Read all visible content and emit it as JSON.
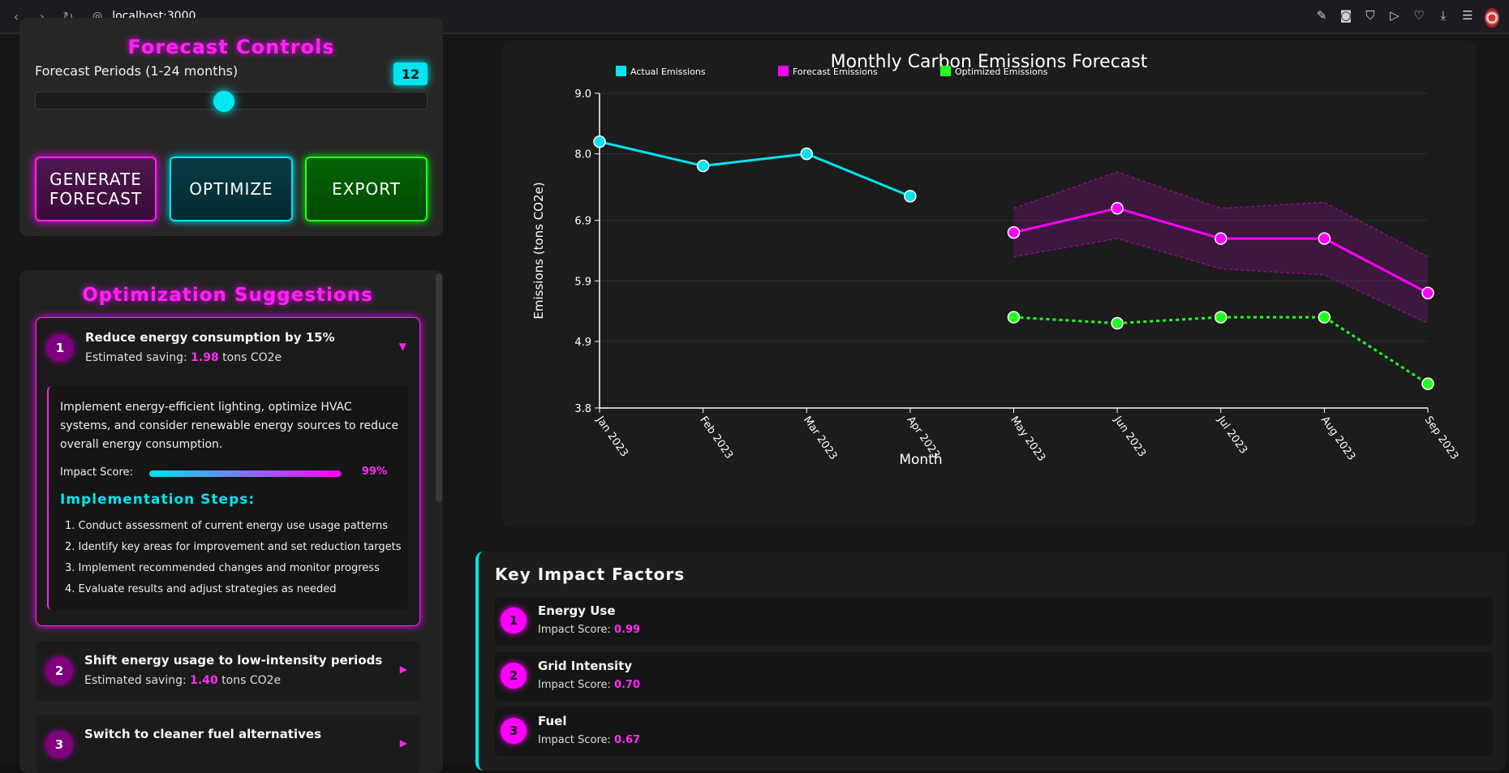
{
  "browser": {
    "url": "localhost:3000",
    "icons": [
      "back-icon",
      "forward-icon",
      "reload-icon",
      "globe-icon",
      "edit-icon",
      "camera-icon",
      "shield-icon",
      "play-icon",
      "heart-icon",
      "download-icon",
      "menu-icon",
      "avatar"
    ]
  },
  "controls": {
    "title": "Forecast Controls",
    "period_label": "Forecast Periods (1-24 months)",
    "period_value": "12",
    "slider_value": 12,
    "slider_min": 1,
    "slider_max": 24,
    "generate_line1": "GENERATE",
    "generate_line2": "FORECAST",
    "optimize_label": "OPTIMIZE",
    "export_label": "EXPORT"
  },
  "optimization": {
    "title": "Optimization Suggestions",
    "saving_prefix": "Estimated saving:",
    "saving_suffix": "tons CO2e",
    "suggestions": [
      {
        "num": "1",
        "title": "Reduce energy consumption by 15%",
        "saving": "1.98",
        "expanded": true,
        "detail": "Implement energy-efficient lighting, optimize HVAC systems, and consider renewable energy sources to reduce overall energy consumption.",
        "impact_label": "Impact Score:",
        "impact_pct": "99%",
        "impact_value": 0.99,
        "steps_title": "Implementation Steps:",
        "steps": [
          "1. Conduct assessment of current energy use usage patterns",
          "2. Identify key areas for improvement and set reduction targets",
          "3. Implement recommended changes and monitor progress",
          "4. Evaluate results and adjust strategies as needed"
        ]
      },
      {
        "num": "2",
        "title": "Shift energy usage to low-intensity periods",
        "saving": "1.40",
        "expanded": false
      },
      {
        "num": "3",
        "title": "Switch to cleaner fuel alternatives",
        "saving": "",
        "expanded": false
      }
    ]
  },
  "chart_data": {
    "type": "line",
    "title": "Monthly Carbon Emissions Forecast",
    "xlabel": "Month",
    "ylabel": "Emissions (tons CO2e)",
    "categories": [
      "Jan 2023",
      "Feb 2023",
      "Mar 2023",
      "Apr 2023",
      "May 2023",
      "Jun 2023",
      "Jul 2023",
      "Aug 2023",
      "Sep 2023"
    ],
    "yticks": [
      "3.8",
      "4.9",
      "5.9",
      "6.9",
      "8.0",
      "9.0"
    ],
    "ylim": [
      3.8,
      9.0
    ],
    "legend": [
      "Actual Emissions",
      "Forecast Emissions",
      "Optimized Emissions"
    ],
    "legend_position": "top-left",
    "series": [
      {
        "name": "Actual Emissions",
        "color": "#00e5ee",
        "style": "solid",
        "values": [
          8.2,
          7.8,
          8.0,
          7.3,
          null,
          null,
          null,
          null,
          null
        ]
      },
      {
        "name": "Forecast Emissions",
        "color": "#ff00ff",
        "style": "solid",
        "values": [
          null,
          null,
          null,
          null,
          6.7,
          7.1,
          6.6,
          6.6,
          5.7
        ]
      },
      {
        "name": "Optimized Emissions",
        "color": "#22ff22",
        "style": "dotted",
        "values": [
          null,
          null,
          null,
          null,
          5.3,
          5.2,
          5.3,
          5.3,
          4.2
        ]
      }
    ],
    "confidence_band": {
      "color": "#ff00ff",
      "upper": [
        null,
        null,
        null,
        null,
        7.1,
        7.7,
        7.1,
        7.2,
        6.3
      ],
      "lower": [
        null,
        null,
        null,
        null,
        6.3,
        6.6,
        6.1,
        6.0,
        5.2
      ]
    }
  },
  "impact": {
    "title": "Key Impact Factors",
    "score_label": "Impact Score:",
    "factors": [
      {
        "num": "1",
        "name": "Energy Use",
        "score": "0.99"
      },
      {
        "num": "2",
        "name": "Grid Intensity",
        "score": "0.70"
      },
      {
        "num": "3",
        "name": "Fuel",
        "score": "0.67"
      }
    ]
  }
}
